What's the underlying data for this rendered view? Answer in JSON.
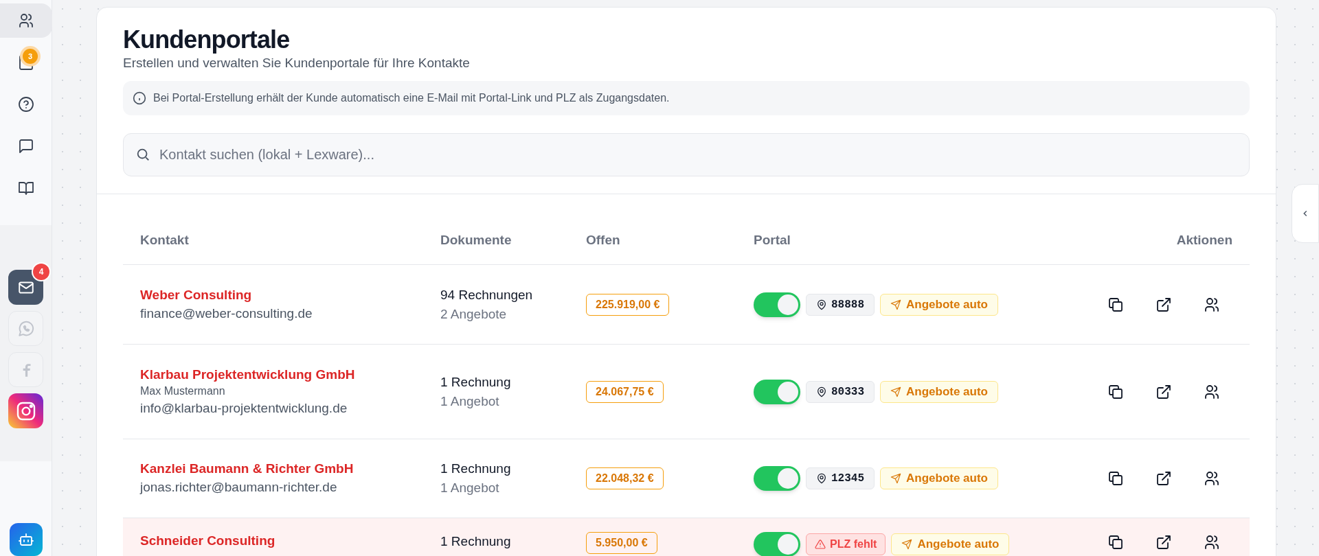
{
  "sidebar": {
    "nav_items": [
      {
        "selected": true
      },
      {
        "selected": false,
        "badge": "3"
      },
      {
        "selected": false
      },
      {
        "selected": false
      },
      {
        "selected": false
      }
    ],
    "channels": [
      {
        "on": true,
        "badge": "4"
      },
      {
        "on": false
      },
      {
        "on": false
      },
      {
        "on": true
      }
    ]
  },
  "header": {
    "title": "Kundenportale",
    "subtitle": "Erstellen und verwalten Sie Kundenportale für Ihre Kontakte",
    "info": "Bei Portal-Erstellung erhält der Kunde automatisch eine E-Mail mit Portal-Link und PLZ als Zugangsdaten.",
    "search": {
      "placeholder": "Kontakt suchen (lokal + Lexware)..."
    }
  },
  "table": {
    "columns": [
      "Kontakt",
      "Dokumente",
      "Offen",
      "Portal",
      "Aktionen"
    ],
    "rows": [
      {
        "name": "Weber Consulting",
        "email": "finance@weber-consulting.de",
        "invoices": "94 Rechnungen",
        "offers": "2 Angebote",
        "open": "225.919,00 €",
        "portal_on": true,
        "plz": {
          "kind": "code",
          "text": "88888"
        },
        "auto_badge": "Angebote auto",
        "highlighted": false
      },
      {
        "name": "Klarbau Projektentwicklung GmbH",
        "person": "Max Mustermann",
        "email": "info@klarbau-projektentwicklung.de",
        "invoices": "1 Rechnung",
        "offers": "1 Angebot",
        "open": "24.067,75 €",
        "portal_on": true,
        "plz": {
          "kind": "code",
          "text": "80333"
        },
        "auto_badge": "Angebote auto",
        "highlighted": false
      },
      {
        "name": "Kanzlei Baumann & Richter GmbH",
        "email": "jonas.richter@baumann-richter.de",
        "invoices": "1 Rechnung",
        "offers": "1 Angebot",
        "open": "22.048,32 €",
        "portal_on": true,
        "plz": {
          "kind": "code",
          "text": "12345"
        },
        "auto_badge": "Angebote auto",
        "highlighted": false
      },
      {
        "name": "Schneider Consulting",
        "invoices": "1 Rechnung",
        "open": "5.950,00 €",
        "portal_on": true,
        "plz": {
          "kind": "missing",
          "text": "PLZ fehlt"
        },
        "auto_badge": "Angebote auto",
        "highlighted": true
      }
    ]
  }
}
